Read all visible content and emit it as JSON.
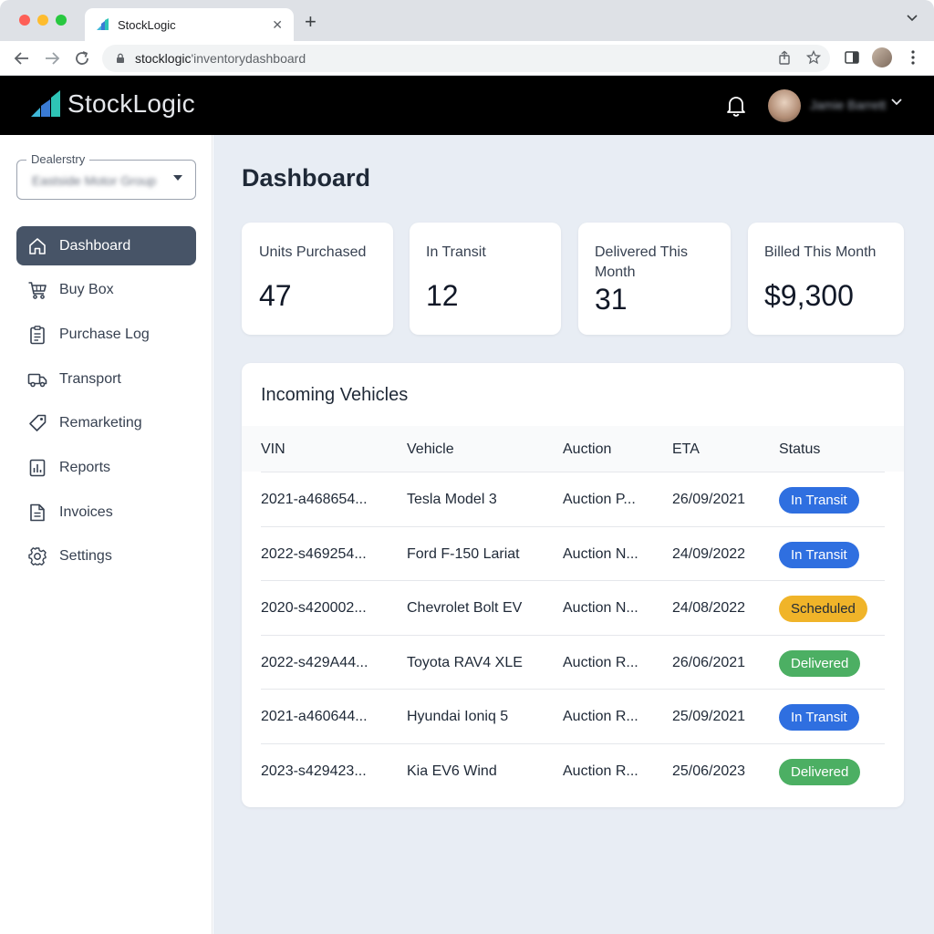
{
  "browser": {
    "tab_title": "StockLogic",
    "url_host": "stocklogic",
    "url_path": "'inventorydashboard"
  },
  "header": {
    "logo_text": "StockLogic",
    "user_name": "Jamie Barrett"
  },
  "sidebar": {
    "dealer_label": "Dealerstry",
    "dealer_value": "Eastside Motor Group",
    "items": [
      {
        "label": "Dashboard",
        "icon": "home-icon",
        "active": true
      },
      {
        "label": "Buy Box",
        "icon": "cart-icon"
      },
      {
        "label": "Purchase Log",
        "icon": "clipboard-icon"
      },
      {
        "label": "Transport",
        "icon": "truck-icon"
      },
      {
        "label": "Remarketing",
        "icon": "tag-icon"
      },
      {
        "label": "Reports",
        "icon": "report-icon"
      },
      {
        "label": "Invoices",
        "icon": "document-icon"
      },
      {
        "label": "Settings",
        "icon": "gear-icon"
      }
    ]
  },
  "main": {
    "title": "Dashboard",
    "cards": [
      {
        "label": "Units Purchased",
        "value": "47"
      },
      {
        "label": "In Transit",
        "value": "12"
      },
      {
        "label": "Delivered This Month",
        "value": "31"
      },
      {
        "label": "Billed This Month",
        "value": "$9,300"
      }
    ],
    "incoming": {
      "title": "Incoming Vehicles",
      "columns": [
        "VIN",
        "Vehicle",
        "Auction",
        "ETA",
        "Status"
      ],
      "rows": [
        {
          "vin": "2021-a468654...",
          "vehicle": "Tesla Model 3",
          "auction": "Auction P...",
          "eta": "26/09/2021",
          "status": "In Transit"
        },
        {
          "vin": "2022-s469254...",
          "vehicle": "Ford F-150 Lariat",
          "auction": "Auction N...",
          "eta": "24/09/2022",
          "status": "In Transit"
        },
        {
          "vin": "2020-s420002...",
          "vehicle": "Chevrolet Bolt EV",
          "auction": "Auction N...",
          "eta": "24/08/2022",
          "status": "Scheduled"
        },
        {
          "vin": "2022-s429A44...",
          "vehicle": "Toyota RAV4 XLE",
          "auction": "Auction R...",
          "eta": "26/06/2021",
          "status": "Delivered"
        },
        {
          "vin": "2021-a460644...",
          "vehicle": "Hyundai Ioniq 5",
          "auction": "Auction R...",
          "eta": "25/09/2021",
          "status": "In Transit"
        },
        {
          "vin": "2023-s429423...",
          "vehicle": "Kia EV6 Wind",
          "auction": "Auction R...",
          "eta": "25/06/2023",
          "status": "Delivered"
        }
      ]
    }
  },
  "colors": {
    "in_transit": "#2f6fe0",
    "scheduled": "#f0b429",
    "delivered": "#4caf63",
    "sidebar_active": "#475467"
  }
}
